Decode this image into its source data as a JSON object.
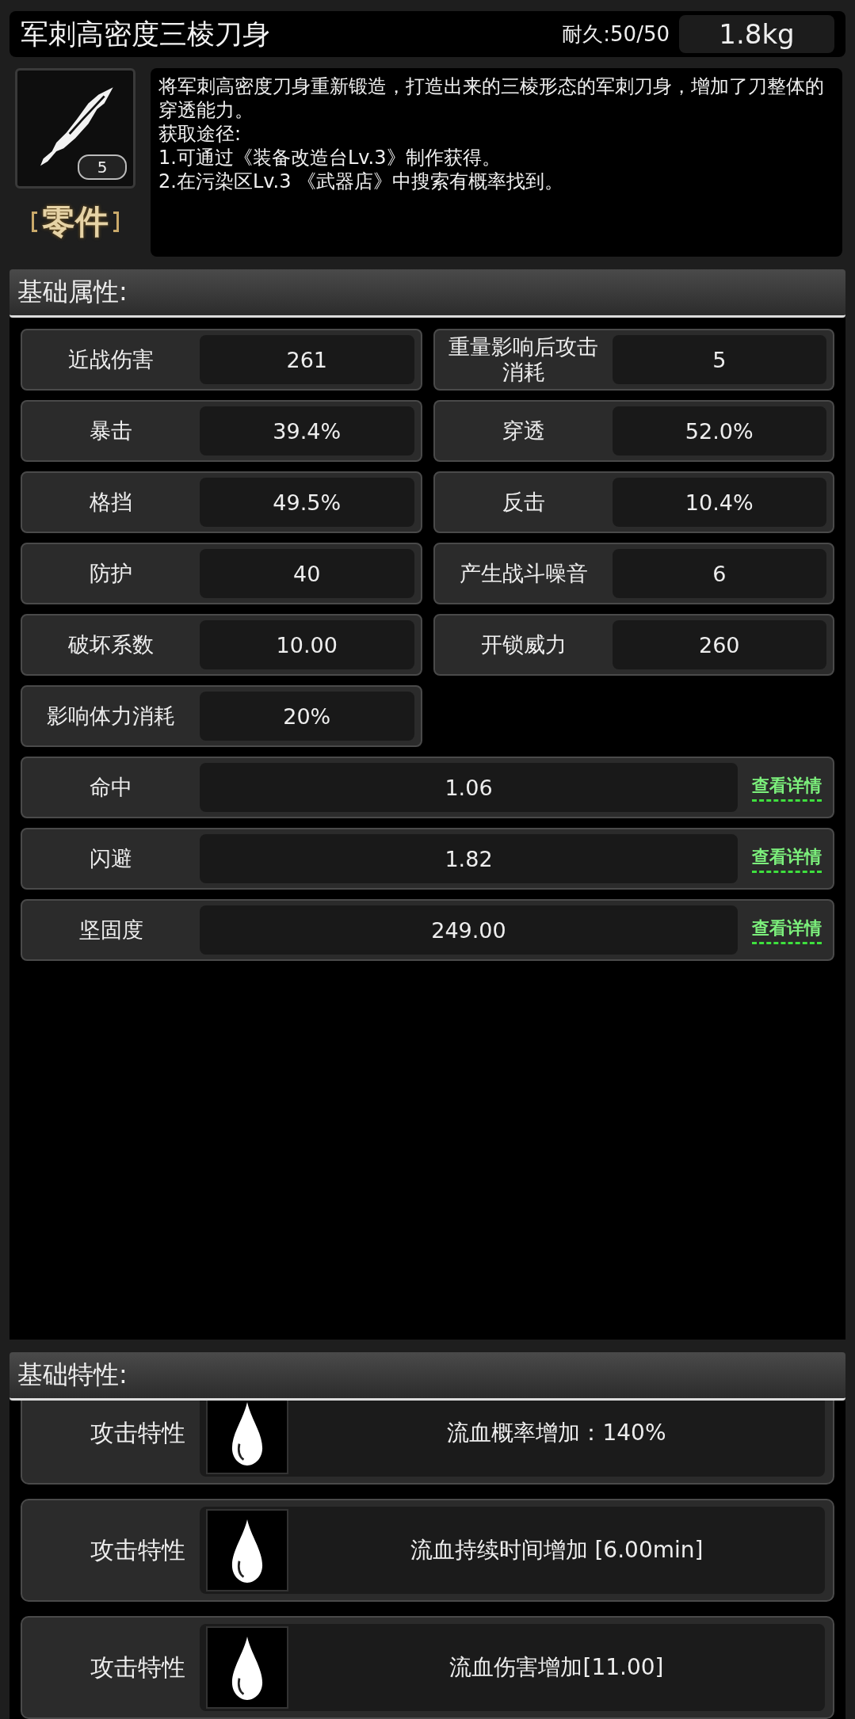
{
  "item": {
    "name": "军刺高密度三棱刀身",
    "durability": "耐久:50/50",
    "weight": "1.8kg",
    "count": "5",
    "category": "零件",
    "description": [
      "将军刺高密度刀身重新锻造，打造出来的三棱形态的军刺刀身，增加了刀整体的穿透能力。",
      "获取途径:",
      "1.可通过《装备改造台Lv.3》制作获得。",
      "2.在污染区Lv.3 《武器店》中搜索有概率找到。"
    ]
  },
  "basic_attributes": {
    "title": "基础属性:",
    "stats": [
      {
        "label": "近战伤害",
        "value": "261"
      },
      {
        "label": "重量影响后攻击消耗",
        "value": "5"
      },
      {
        "label": "暴击",
        "value": "39.4%"
      },
      {
        "label": "穿透",
        "value": "52.0%"
      },
      {
        "label": "格挡",
        "value": "49.5%"
      },
      {
        "label": "反击",
        "value": "10.4%"
      },
      {
        "label": "防护",
        "value": "40"
      },
      {
        "label": "产生战斗噪音",
        "value": "6"
      },
      {
        "label": "破坏系数",
        "value": "10.00"
      },
      {
        "label": "开锁威力",
        "value": "260"
      },
      {
        "label": "影响体力消耗",
        "value": "20%"
      }
    ],
    "details": [
      {
        "label": "命中",
        "value": "1.06",
        "link": "查看详情"
      },
      {
        "label": "闪避",
        "value": "1.82",
        "link": "查看详情"
      },
      {
        "label": "坚固度",
        "value": "249.00",
        "link": "查看详情"
      }
    ]
  },
  "basic_traits": {
    "title": "基础特性:",
    "traits": [
      {
        "label": "攻击特性",
        "text": "流血概率增加：140%"
      },
      {
        "label": "攻击特性",
        "text": "流血持续时间增加 [6.00min]"
      },
      {
        "label": "攻击特性",
        "text": "流血伤害增加[11.00]"
      }
    ]
  }
}
